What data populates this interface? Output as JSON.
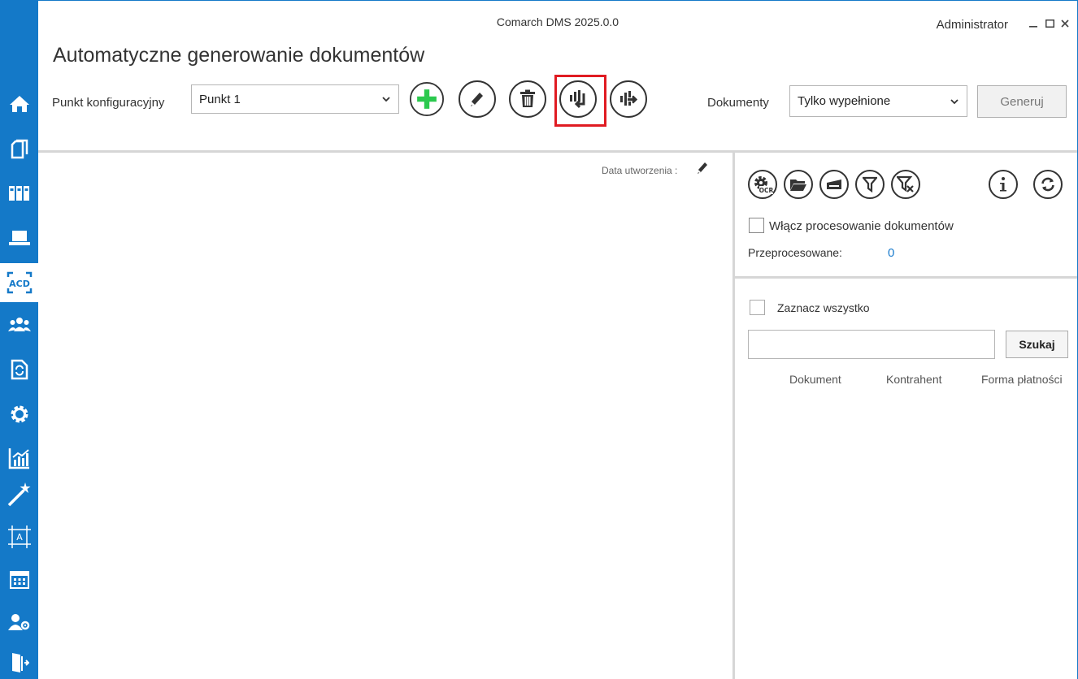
{
  "window": {
    "title": "Comarch DMS 2025.0.0",
    "user": "Administrator"
  },
  "page": {
    "title": "Automatyczne generowanie dokumentów"
  },
  "toolbar": {
    "config_point_label": "Punkt konfiguracyjny",
    "config_point_value": "Punkt 1",
    "documents_label": "Dokumenty",
    "documents_value": "Tylko wypełnione",
    "generate_label": "Generuj",
    "highlight_color": "#e01b22",
    "add_icon_color": "#2bc94e"
  },
  "sidebar": {
    "color": "#1479c8",
    "items": [
      {
        "icon": "home-icon"
      },
      {
        "icon": "documents-icon"
      },
      {
        "icon": "binders-icon"
      },
      {
        "icon": "laptop-icon"
      },
      {
        "icon": "acd-icon",
        "label": "ACD",
        "active": true
      },
      {
        "icon": "users-icon"
      },
      {
        "icon": "document-sync-icon"
      },
      {
        "icon": "gear-icon"
      },
      {
        "icon": "chart-icon"
      },
      {
        "icon": "magic-wand-icon"
      },
      {
        "icon": "template-icon"
      },
      {
        "icon": "calendar-icon"
      },
      {
        "icon": "user-settings-icon"
      },
      {
        "icon": "exit-icon"
      }
    ]
  },
  "left_panel": {
    "created_date_label": "Data utworzenia :"
  },
  "right_panel": {
    "process_docs_label": "Włącz procesowanie dokumentów",
    "processed_label": "Przeprocesowane:",
    "processed_count": "0",
    "select_all_label": "Zaznacz wszystko",
    "search_button": "Szukaj",
    "columns": [
      "Dokument",
      "Kontrahent",
      "Forma płatności"
    ],
    "accent_color": "#1a7ccd"
  }
}
